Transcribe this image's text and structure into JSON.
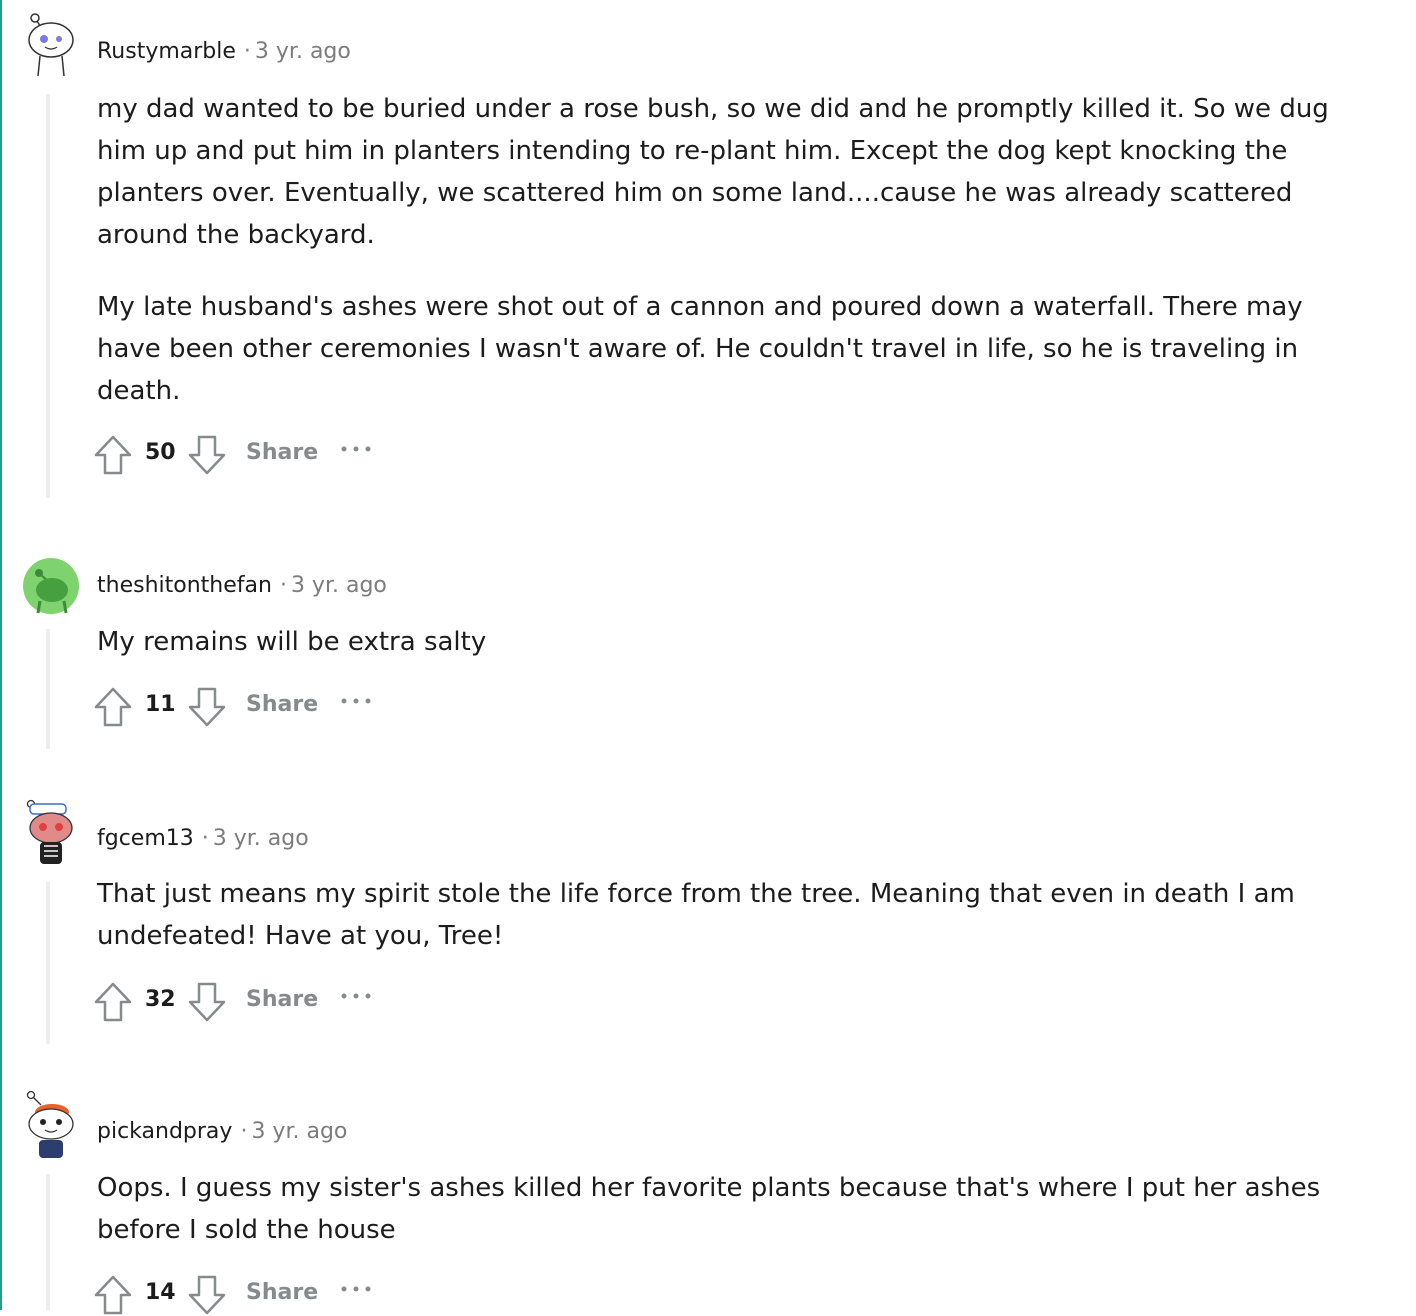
{
  "colors": {
    "accent": "#1aa38a",
    "meta": "#7c7c7c",
    "share": "#878a8c"
  },
  "comments": [
    {
      "username": "Rustymarble",
      "time": "3 yr. ago",
      "avatar_icon": "snoo-avatar-icon",
      "paragraphs": [
        "my dad wanted to be buried under a rose bush, so we did and he promptly killed it. So we dug him up and put him in planters intending to re-plant him. Except the dog kept knocking the planters over. Eventually, we scattered him on some land....cause he was already scattered around the backyard.",
        "My late husband's ashes were shot out of a cannon and poured down a waterfall. There may have been other ceremonies I wasn't aware of. He couldn't travel in life, so he is traveling in death."
      ],
      "score": "50",
      "share_label": "Share"
    },
    {
      "username": "theshitonthefan",
      "time": "3 yr. ago",
      "avatar_icon": "green-snoo-avatar-icon",
      "paragraphs": [
        "My remains will be extra salty"
      ],
      "score": "11",
      "share_label": "Share"
    },
    {
      "username": "fgcem13",
      "time": "3 yr. ago",
      "avatar_icon": "custom-snoo-avatar-icon",
      "paragraphs": [
        "That just means my spirit stole the life force from the tree. Meaning that even in death I am undefeated! Have at you, Tree!"
      ],
      "score": "32",
      "share_label": "Share"
    },
    {
      "username": "pickandpray",
      "time": "3 yr. ago",
      "avatar_icon": "custom-snoo-avatar-icon",
      "paragraphs": [
        "Oops. I guess my sister's ashes killed her favorite plants because that's where I put her ashes before I sold the house"
      ],
      "score": "14",
      "share_label": "Share"
    }
  ]
}
